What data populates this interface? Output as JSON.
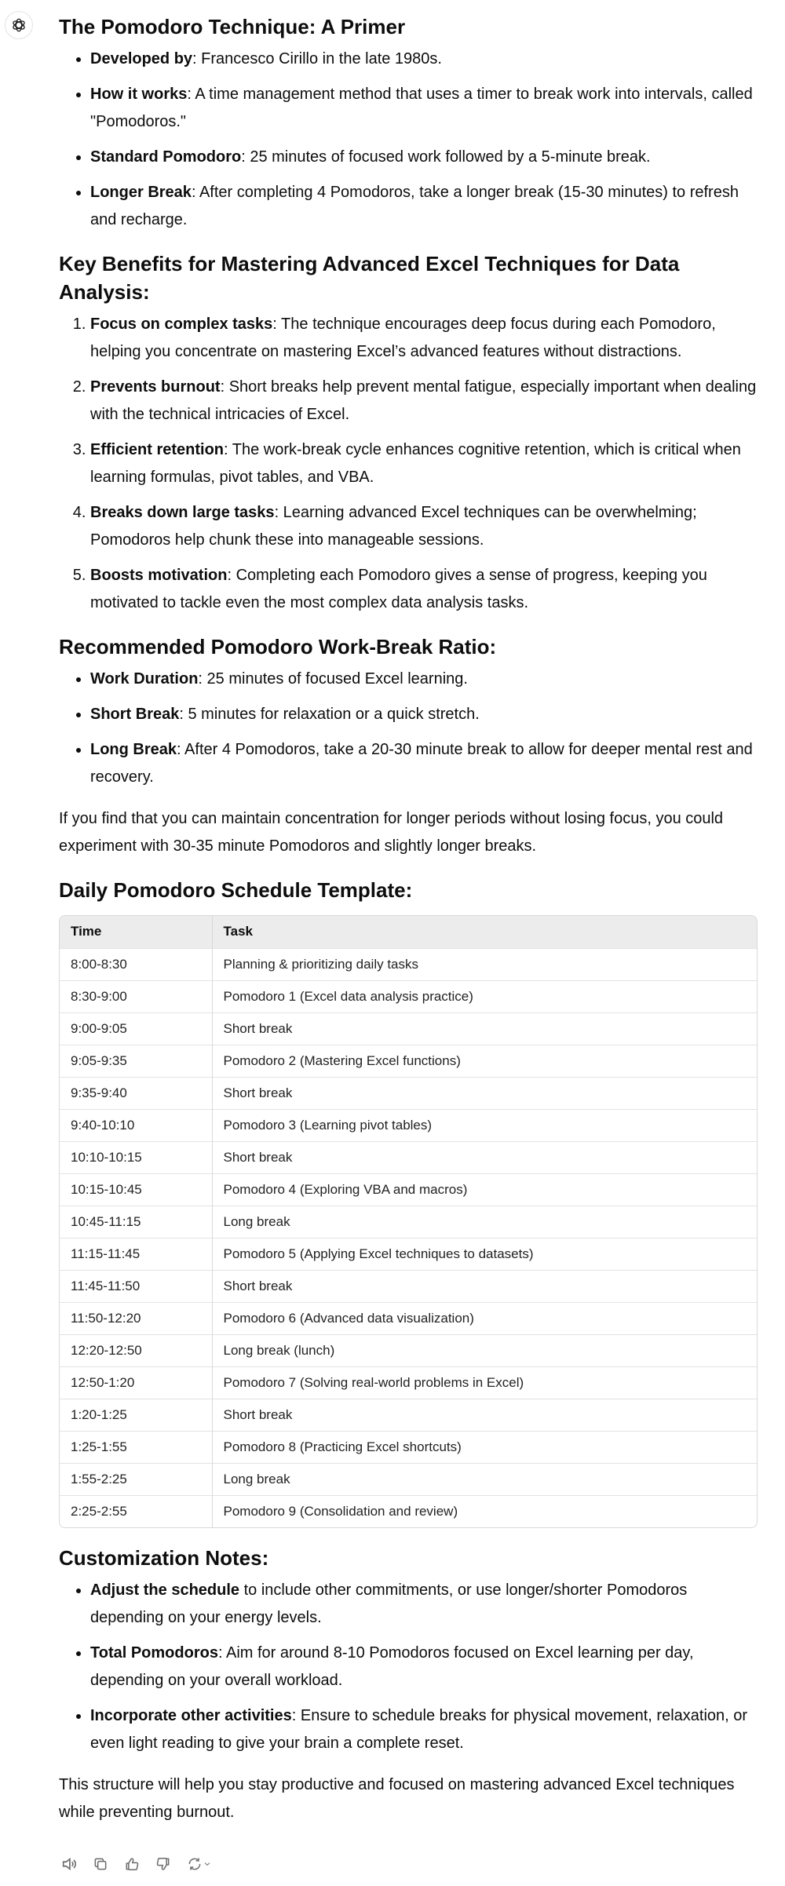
{
  "assistant": {
    "avatar_icon": "openai-logo-icon"
  },
  "sections": {
    "primer": {
      "heading": "The Pomodoro Technique: A Primer",
      "items": [
        {
          "label": "Developed by",
          "text": ": Francesco Cirillo in the late 1980s."
        },
        {
          "label": "How it works",
          "text": ": A time management method that uses a timer to break work into intervals, called \"Pomodoros.\""
        },
        {
          "label": "Standard Pomodoro",
          "text": ": 25 minutes of focused work followed by a 5-minute break."
        },
        {
          "label": "Longer Break",
          "text": ": After completing 4 Pomodoros, take a longer break (15-30 minutes) to refresh and recharge."
        }
      ]
    },
    "benefits": {
      "heading": "Key Benefits for Mastering Advanced Excel Techniques for Data Analysis:",
      "items": [
        {
          "label": "Focus on complex tasks",
          "text": ": The technique encourages deep focus during each Pomodoro, helping you concentrate on mastering Excel’s advanced features without distractions."
        },
        {
          "label": "Prevents burnout",
          "text": ": Short breaks help prevent mental fatigue, especially important when dealing with the technical intricacies of Excel."
        },
        {
          "label": "Efficient retention",
          "text": ": The work-break cycle enhances cognitive retention, which is critical when learning formulas, pivot tables, and VBA."
        },
        {
          "label": "Breaks down large tasks",
          "text": ": Learning advanced Excel techniques can be overwhelming; Pomodoros help chunk these into manageable sessions."
        },
        {
          "label": "Boosts motivation",
          "text": ": Completing each Pomodoro gives a sense of progress, keeping you motivated to tackle even the most complex data analysis tasks."
        }
      ]
    },
    "ratio": {
      "heading": "Recommended Pomodoro Work-Break Ratio:",
      "items": [
        {
          "label": "Work Duration",
          "text": ": 25 minutes of focused Excel learning."
        },
        {
          "label": "Short Break",
          "text": ": 5 minutes for relaxation or a quick stretch."
        },
        {
          "label": "Long Break",
          "text": ": After 4 Pomodoros, take a 20-30 minute break to allow for deeper mental rest and recovery."
        }
      ],
      "note": "If you find that you can maintain concentration for longer periods without losing focus, you could experiment with 30-35 minute Pomodoros and slightly longer breaks."
    },
    "schedule": {
      "heading": "Daily Pomodoro Schedule Template:",
      "columns": [
        "Time",
        "Task"
      ],
      "rows": [
        [
          "8:00-8:30",
          "Planning & prioritizing daily tasks"
        ],
        [
          "8:30-9:00",
          "Pomodoro 1 (Excel data analysis practice)"
        ],
        [
          "9:00-9:05",
          "Short break"
        ],
        [
          "9:05-9:35",
          "Pomodoro 2 (Mastering Excel functions)"
        ],
        [
          "9:35-9:40",
          "Short break"
        ],
        [
          "9:40-10:10",
          "Pomodoro 3 (Learning pivot tables)"
        ],
        [
          "10:10-10:15",
          "Short break"
        ],
        [
          "10:15-10:45",
          "Pomodoro 4 (Exploring VBA and macros)"
        ],
        [
          "10:45-11:15",
          "Long break"
        ],
        [
          "11:15-11:45",
          "Pomodoro 5 (Applying Excel techniques to datasets)"
        ],
        [
          "11:45-11:50",
          "Short break"
        ],
        [
          "11:50-12:20",
          "Pomodoro 6 (Advanced data visualization)"
        ],
        [
          "12:20-12:50",
          "Long break (lunch)"
        ],
        [
          "12:50-1:20",
          "Pomodoro 7 (Solving real-world problems in Excel)"
        ],
        [
          "1:20-1:25",
          "Short break"
        ],
        [
          "1:25-1:55",
          "Pomodoro 8 (Practicing Excel shortcuts)"
        ],
        [
          "1:55-2:25",
          "Long break"
        ],
        [
          "2:25-2:55",
          "Pomodoro 9 (Consolidation and review)"
        ]
      ]
    },
    "customization": {
      "heading": "Customization Notes:",
      "items": [
        {
          "label": "Adjust the schedule",
          "text": " to include other commitments, or use longer/shorter Pomodoros depending on your energy levels."
        },
        {
          "label": "Total Pomodoros",
          "text": ": Aim for around 8-10 Pomodoros focused on Excel learning per day, depending on your overall workload."
        },
        {
          "label": "Incorporate other activities",
          "text": ": Ensure to schedule breaks for physical movement, relaxation, or even light reading to give your brain a complete reset."
        }
      ],
      "closing": "This structure will help you stay productive and focused on mastering advanced Excel techniques while preventing burnout."
    }
  },
  "actions": [
    "read-aloud-icon",
    "copy-icon",
    "thumbs-up-icon",
    "thumbs-down-icon",
    "regenerate-icon"
  ]
}
